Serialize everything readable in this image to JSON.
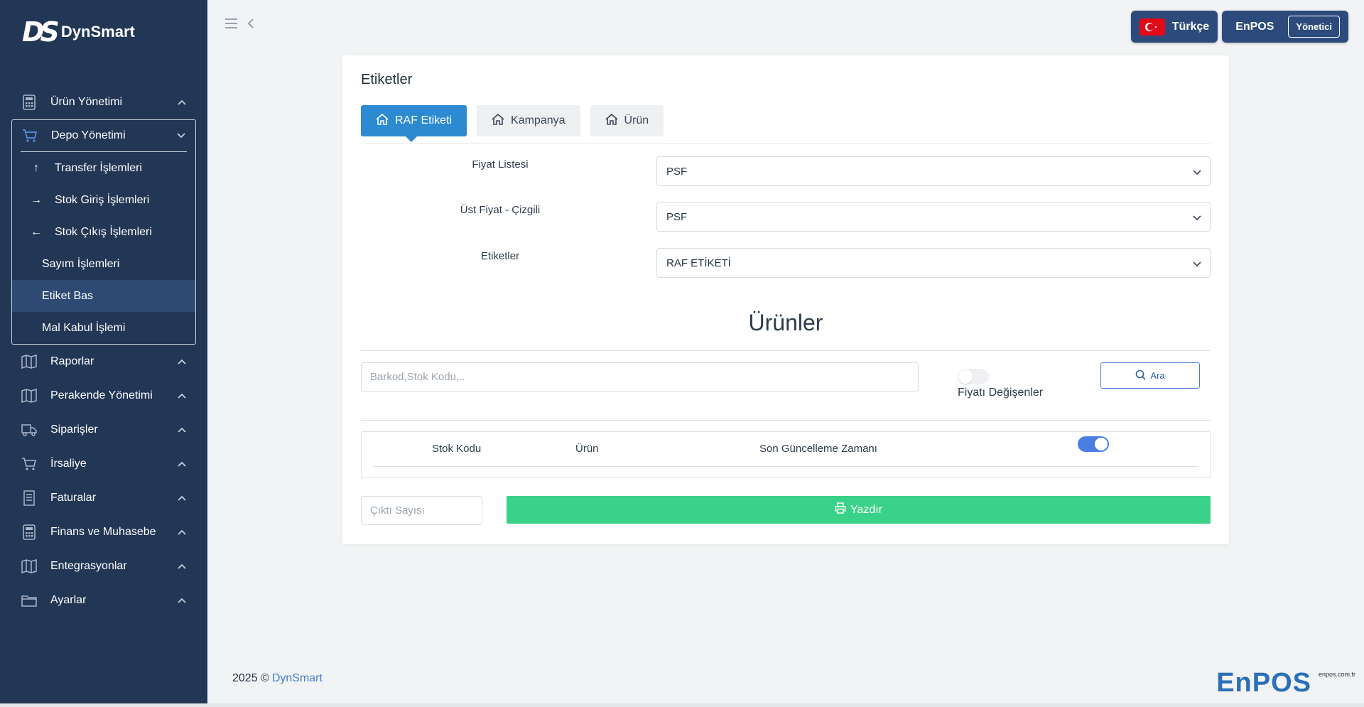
{
  "brand": {
    "logo_mark": "DS",
    "name": "DynSmart"
  },
  "sidebar": {
    "items": [
      {
        "label": "Ürün Yönetimi",
        "icon": "calculator-icon"
      },
      {
        "label": "Depo Yönetimi",
        "icon": "cart-icon",
        "expanded": true,
        "children": [
          {
            "label": "Transfer İşlemleri",
            "arrow": "↑"
          },
          {
            "label": "Stok Giriş İşlemleri",
            "arrow": "→"
          },
          {
            "label": "Stok Çıkış İşlemleri",
            "arrow": "←"
          },
          {
            "label": "Sayım İşlemleri"
          },
          {
            "label": "Etiket Bas",
            "active": true
          },
          {
            "label": "Mal Kabul İşlemi"
          }
        ]
      },
      {
        "label": "Raporlar",
        "icon": "map-icon"
      },
      {
        "label": "Perakende Yönetimi",
        "icon": "map-icon"
      },
      {
        "label": "Siparişler",
        "icon": "truck-icon"
      },
      {
        "label": "İrsaliye",
        "icon": "cart-icon"
      },
      {
        "label": "Faturalar",
        "icon": "receipt-icon"
      },
      {
        "label": "Finans ve Muhasebe",
        "icon": "calculator-icon"
      },
      {
        "label": "Entegrasyonlar",
        "icon": "map-icon"
      },
      {
        "label": "Ayarlar",
        "icon": "folder-icon"
      }
    ]
  },
  "topbar": {
    "language": "Türkçe",
    "company": "EnPOS",
    "role": "Yönetici"
  },
  "page": {
    "title": "Etiketler",
    "tabs": [
      {
        "label": "RAF Etiketi",
        "active": true
      },
      {
        "label": "Kampanya"
      },
      {
        "label": "Ürün"
      }
    ],
    "fields": {
      "price_list": {
        "label": "Fiyat Listesi",
        "value": "PSF"
      },
      "upper_price": {
        "label": "Üst Fiyat - Çizgili",
        "value": "PSF"
      },
      "labels": {
        "label": "Etiketler",
        "value": "RAF ETİKETİ"
      }
    },
    "products_title": "Ürünler",
    "search": {
      "placeholder": "Barkod,Stok Kodu,..",
      "button": "Ara"
    },
    "price_changed_toggle": {
      "label": "Fiyatı Değişenler",
      "on": false
    },
    "table": {
      "columns": [
        "Stok Kodu",
        "Ürün",
        "Son Güncelleme Zamanı"
      ],
      "select_all_on": true
    },
    "print_count": {
      "placeholder": "Çıktı Sayısı"
    },
    "print_button": "Yazdır"
  },
  "footer": {
    "year_text": "2025 ©",
    "link": "DynSmart",
    "brand": "EnPOS",
    "domain": "enpos.com.tr"
  },
  "colors": {
    "sidebar": "#223655",
    "accent": "#2c8ad1",
    "print": "#3ad288",
    "toggle_on": "#4a7ee2"
  }
}
